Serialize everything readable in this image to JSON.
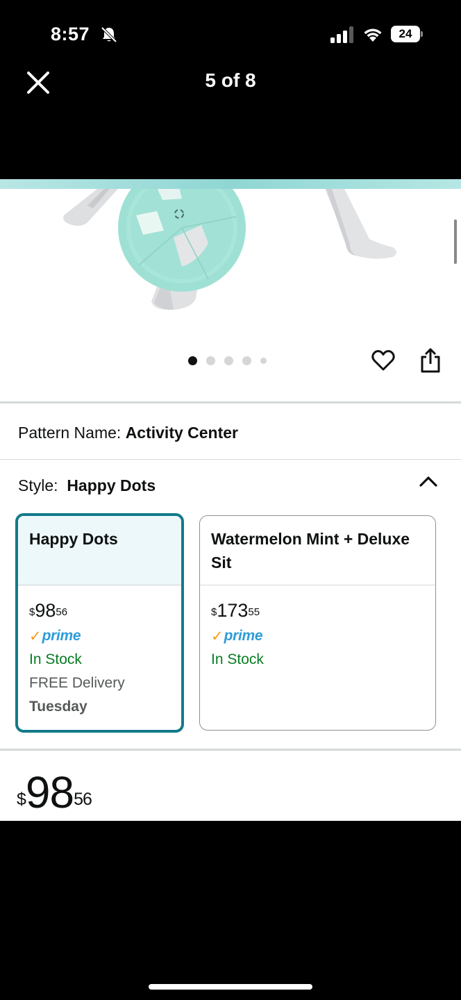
{
  "status_bar": {
    "time": "8:57",
    "battery": "24"
  },
  "viewer": {
    "counter": "5 of 8"
  },
  "gallery": {
    "dot_count": 5,
    "active_dot": 1
  },
  "pattern": {
    "label": "Pattern Name:",
    "value": "Activity Center"
  },
  "style": {
    "label": "Style:",
    "value": "Happy Dots"
  },
  "options": [
    {
      "title": "Happy Dots",
      "price_symbol": "$",
      "price_whole": "98",
      "price_fraction": "56",
      "prime_check": "✓",
      "prime": "prime",
      "stock": "In Stock",
      "delivery": "FREE Delivery",
      "delivery_day": "Tuesday"
    },
    {
      "title": "Watermelon Mint + Deluxe Sit",
      "price_symbol": "$",
      "price_whole": "173",
      "price_fraction": "55",
      "prime_check": "✓",
      "prime": "prime",
      "stock": "In Stock"
    }
  ],
  "price": {
    "symbol": "$",
    "whole": "98",
    "fraction": "56"
  },
  "colors": {
    "selected_border": "#127a8a",
    "selected_bg": "#edf8fa",
    "in_stock": "#067d23",
    "prime_blue": "#2f9cd8",
    "prime_check": "#f79a18",
    "product_teal": "#9fe0d4"
  }
}
